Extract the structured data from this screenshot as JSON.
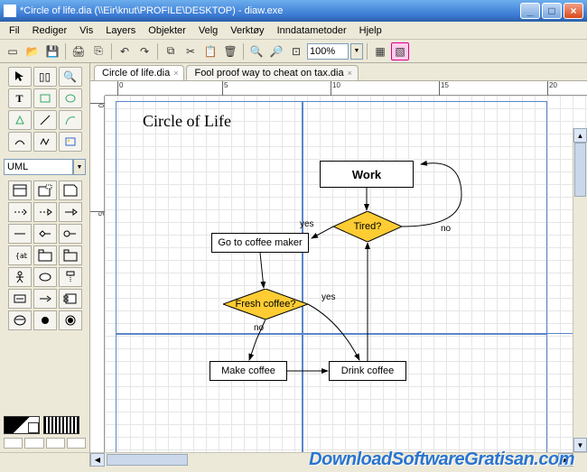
{
  "window": {
    "title": "*Circle of life.dia (\\\\Eir\\knut\\PROFILE\\DESKTOP) - diaw.exe"
  },
  "menu": {
    "items": [
      "Fil",
      "Rediger",
      "Vis",
      "Layers",
      "Objekter",
      "Velg",
      "Verktøy",
      "Inndatametoder",
      "Hjelp"
    ]
  },
  "toolbar": {
    "zoom_value": "100%"
  },
  "left": {
    "shape_category": "UML"
  },
  "tabs": [
    {
      "label": "Circle of life.dia",
      "active": true
    },
    {
      "label": "Fool proof way to cheat on tax.dia",
      "active": false
    }
  ],
  "ruler_h": [
    "0",
    "5",
    "10",
    "15",
    "20"
  ],
  "ruler_v": [
    "0",
    "5"
  ],
  "diagram": {
    "title": "Circle of Life",
    "nodes": {
      "work": "Work",
      "tired": "Tired?",
      "goto_maker": "Go to coffee maker",
      "fresh": "Fresh coffee?",
      "make": "Make coffee",
      "drink": "Drink coffee"
    },
    "edge_labels": {
      "tired_yes": "yes",
      "tired_no": "no",
      "fresh_yes": "yes",
      "fresh_no": "no"
    }
  },
  "watermark": "DownloadSoftwareGratisan.com"
}
